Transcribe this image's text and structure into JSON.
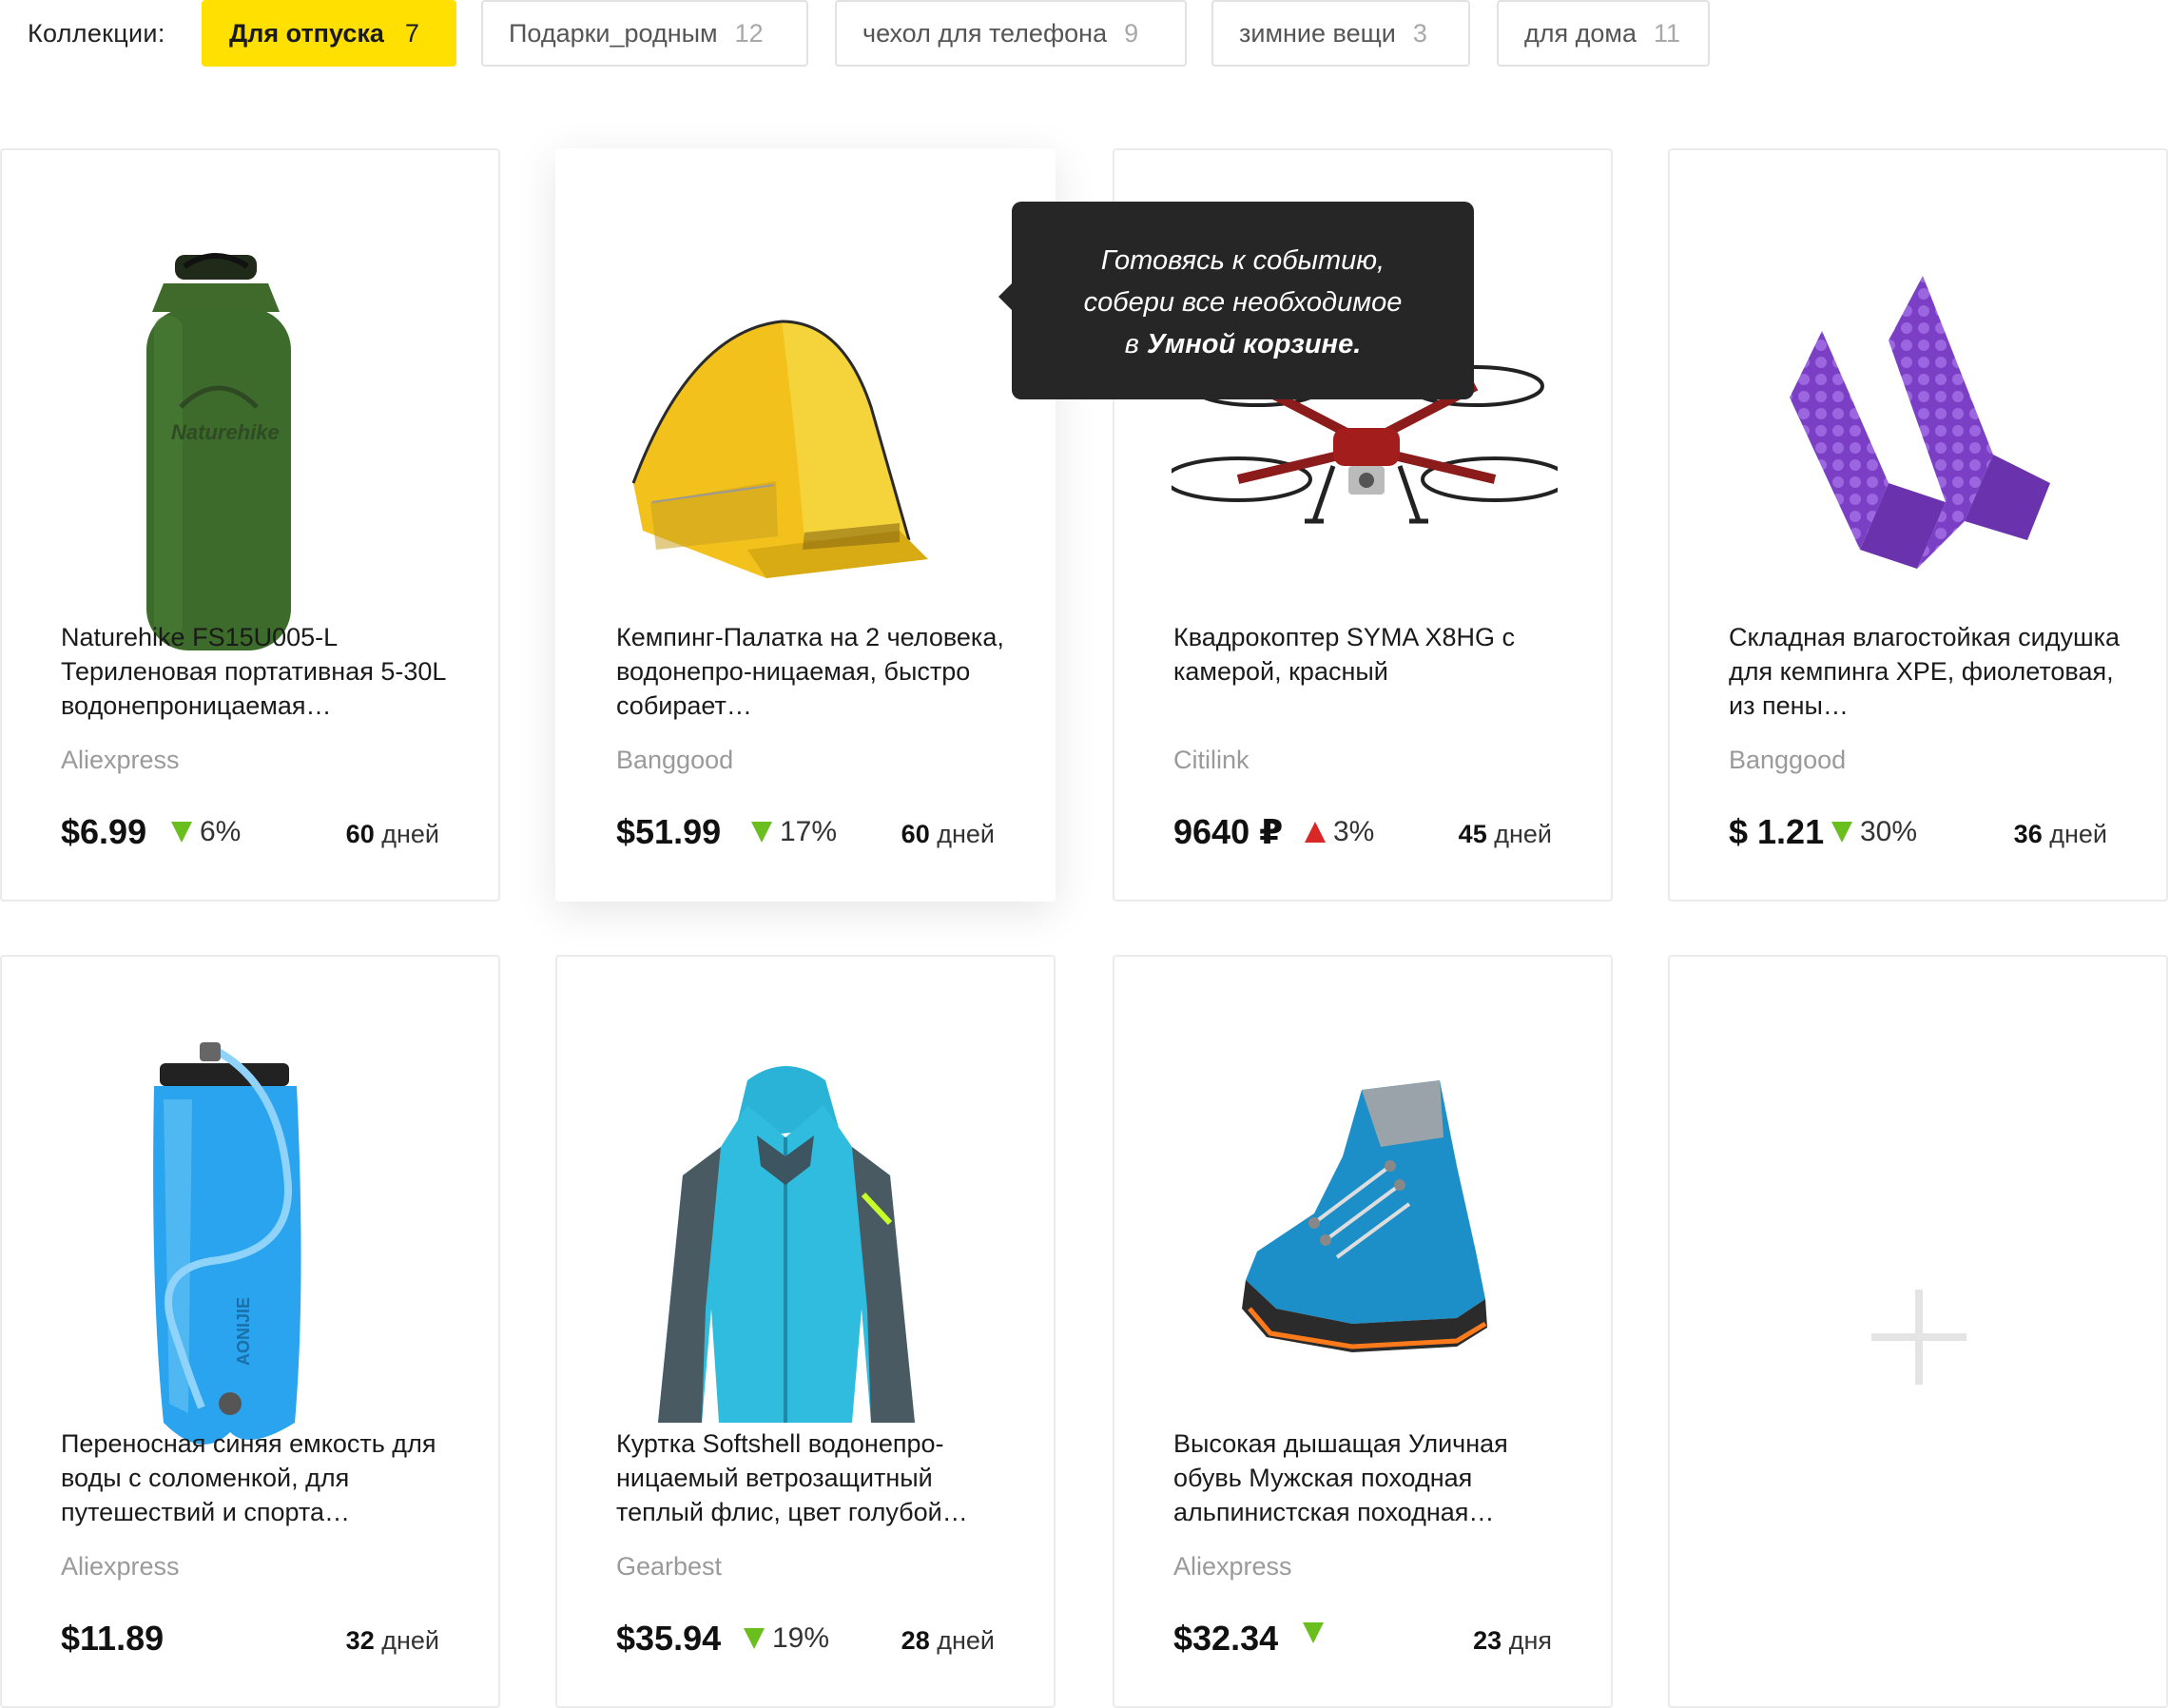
{
  "collections": {
    "label": "Коллекции:",
    "chips": [
      {
        "name": "Для отпуска",
        "count": "7",
        "active": true
      },
      {
        "name": "Подарки_родным",
        "count": "12"
      },
      {
        "name": "чехол для телефона",
        "count": "9"
      },
      {
        "name": "зимние вещи",
        "count": "3"
      },
      {
        "name": "для дома",
        "count": "11"
      }
    ]
  },
  "tooltip": {
    "line1": "Готовясь к событию,",
    "line2": "собери все необходимое",
    "line3_prefix": "в",
    "line3_bold": "Умной корзине."
  },
  "products": [
    {
      "title": "Naturehike FS15U005-L Териленовая портативная 5-30L водонепроницаемая…",
      "store": "Aliexpress",
      "price": "$6.99",
      "change": "6%",
      "trend": "down",
      "days_num": "60",
      "days_unit": "дней",
      "image": "dry-bag"
    },
    {
      "title": "Кемпинг-Палатка на 2 человека, водонепро-ницаемая, быстро собирает…",
      "store": "Banggood",
      "price": "$51.99",
      "change": "17%",
      "trend": "down",
      "days_num": "60",
      "days_unit": "дней",
      "image": "tent"
    },
    {
      "title": "Квадрокоптер SYMA X8HG с камерой, красный",
      "store": "Citilink",
      "price": "9640 ₽",
      "change": "3%",
      "trend": "up",
      "days_num": "45",
      "days_unit": "дней",
      "image": "drone"
    },
    {
      "title": "Складная влагостойкая сидушка для кемпинга XPE, фиолетовая, из пены…",
      "store": "Banggood",
      "price": "$ 1.21",
      "change": "30%",
      "trend": "down",
      "days_num": "36",
      "days_unit": "дней",
      "image": "foam-pad"
    },
    {
      "title": "Переносная синяя емкость для воды с соломенкой, для путешествий и спорта…",
      "store": "Aliexpress",
      "price": "$11.89",
      "change": "",
      "trend": "none",
      "days_num": "32",
      "days_unit": "дней",
      "image": "water-bladder"
    },
    {
      "title": "Куртка Softshell водонепро-ницаемый ветрозащитный теплый флис, цвет голубой…",
      "store": "Gearbest",
      "price": "$35.94",
      "change": "19%",
      "trend": "down",
      "days_num": "28",
      "days_unit": "дней",
      "image": "jacket"
    },
    {
      "title": "Высокая дышащая Уличная обувь Мужская походная альпинистская походная…",
      "store": "Aliexpress",
      "price": "$32.34",
      "change": "",
      "trend": "down",
      "days_num": "23",
      "days_unit": "дня",
      "image": "hiking-boot"
    }
  ],
  "colors": {
    "accent": "#ffe000",
    "price_down": "#6abf1e",
    "price_up": "#d82727",
    "tooltip_bg": "#262626"
  }
}
